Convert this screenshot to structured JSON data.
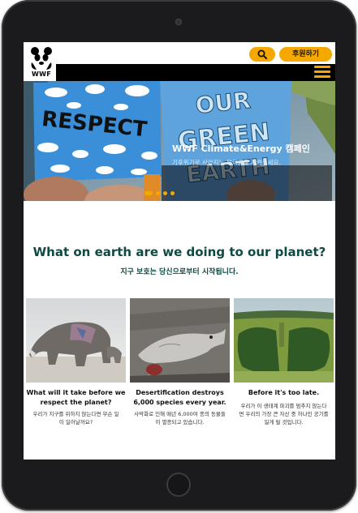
{
  "header": {
    "logo_text": "WWF",
    "donate_label": "후원하기"
  },
  "hero": {
    "title": "WWF Climate&Energy 캠페인",
    "subtitle": "기후위기로 사라지는 북극곰을 지켜주세요.",
    "sign_left": "RESPECT",
    "sign_right_lines": [
      "OUR",
      "GREEN",
      "EARTH"
    ],
    "slides_count": 4,
    "active_slide": 1
  },
  "main": {
    "headline": "What on earth are we doing to our planet?",
    "subline": "지구 보호는 당신으로부터 시작됩니다.",
    "cards": [
      {
        "title_line1": "What will it take before we",
        "title_line2": "respect the planet?",
        "desc_line1": "우리가 지구를 위하지 않는다면 무슨 일",
        "desc_line2": "이 일어날까요?"
      },
      {
        "title_line1": "Desertification destroys",
        "title_line2": "6,000 species every year.",
        "desc_line1": "사막화로 인해 매년 6,000여 종의 동물들",
        "desc_line2": "이 멸종되고 있습니다."
      },
      {
        "title_line1": "Before it's too late.",
        "title_line2": "",
        "desc_line1": "우리가 이 생태계 파괴를 멈추지 않는다",
        "desc_line2": "면 우리의 가장 큰 자산 중 하나인 공기를",
        "desc_line3": "잃게 될 것입니다."
      }
    ]
  },
  "colors": {
    "accent": "#f5a800",
    "heading": "#0e4a42",
    "navbar": "#000000",
    "device_frame": "#1b1b1d"
  }
}
